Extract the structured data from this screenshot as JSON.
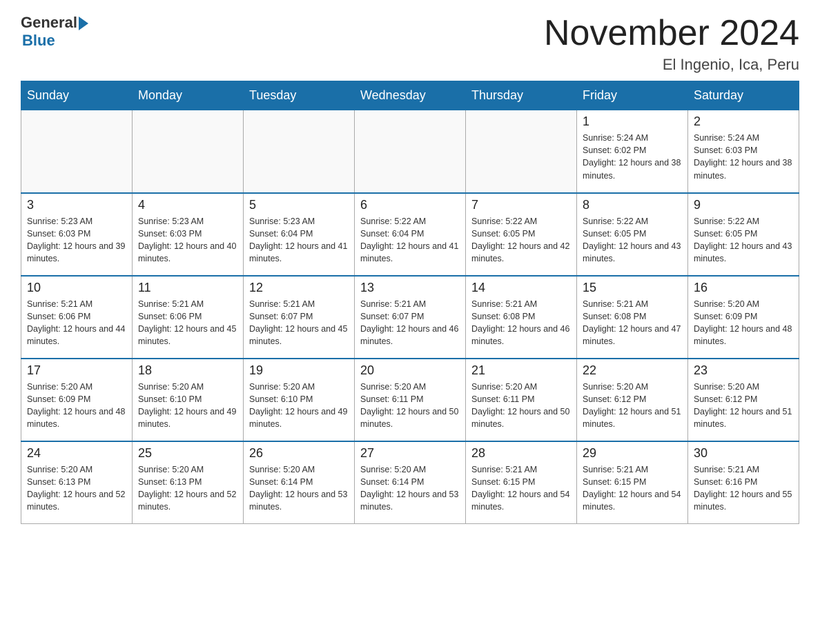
{
  "header": {
    "logo_general": "General",
    "logo_blue": "Blue",
    "month_title": "November 2024",
    "location": "El Ingenio, Ica, Peru"
  },
  "days_of_week": [
    "Sunday",
    "Monday",
    "Tuesday",
    "Wednesday",
    "Thursday",
    "Friday",
    "Saturday"
  ],
  "weeks": [
    [
      {
        "day": "",
        "info": ""
      },
      {
        "day": "",
        "info": ""
      },
      {
        "day": "",
        "info": ""
      },
      {
        "day": "",
        "info": ""
      },
      {
        "day": "",
        "info": ""
      },
      {
        "day": "1",
        "info": "Sunrise: 5:24 AM\nSunset: 6:02 PM\nDaylight: 12 hours and 38 minutes."
      },
      {
        "day": "2",
        "info": "Sunrise: 5:24 AM\nSunset: 6:03 PM\nDaylight: 12 hours and 38 minutes."
      }
    ],
    [
      {
        "day": "3",
        "info": "Sunrise: 5:23 AM\nSunset: 6:03 PM\nDaylight: 12 hours and 39 minutes."
      },
      {
        "day": "4",
        "info": "Sunrise: 5:23 AM\nSunset: 6:03 PM\nDaylight: 12 hours and 40 minutes."
      },
      {
        "day": "5",
        "info": "Sunrise: 5:23 AM\nSunset: 6:04 PM\nDaylight: 12 hours and 41 minutes."
      },
      {
        "day": "6",
        "info": "Sunrise: 5:22 AM\nSunset: 6:04 PM\nDaylight: 12 hours and 41 minutes."
      },
      {
        "day": "7",
        "info": "Sunrise: 5:22 AM\nSunset: 6:05 PM\nDaylight: 12 hours and 42 minutes."
      },
      {
        "day": "8",
        "info": "Sunrise: 5:22 AM\nSunset: 6:05 PM\nDaylight: 12 hours and 43 minutes."
      },
      {
        "day": "9",
        "info": "Sunrise: 5:22 AM\nSunset: 6:05 PM\nDaylight: 12 hours and 43 minutes."
      }
    ],
    [
      {
        "day": "10",
        "info": "Sunrise: 5:21 AM\nSunset: 6:06 PM\nDaylight: 12 hours and 44 minutes."
      },
      {
        "day": "11",
        "info": "Sunrise: 5:21 AM\nSunset: 6:06 PM\nDaylight: 12 hours and 45 minutes."
      },
      {
        "day": "12",
        "info": "Sunrise: 5:21 AM\nSunset: 6:07 PM\nDaylight: 12 hours and 45 minutes."
      },
      {
        "day": "13",
        "info": "Sunrise: 5:21 AM\nSunset: 6:07 PM\nDaylight: 12 hours and 46 minutes."
      },
      {
        "day": "14",
        "info": "Sunrise: 5:21 AM\nSunset: 6:08 PM\nDaylight: 12 hours and 46 minutes."
      },
      {
        "day": "15",
        "info": "Sunrise: 5:21 AM\nSunset: 6:08 PM\nDaylight: 12 hours and 47 minutes."
      },
      {
        "day": "16",
        "info": "Sunrise: 5:20 AM\nSunset: 6:09 PM\nDaylight: 12 hours and 48 minutes."
      }
    ],
    [
      {
        "day": "17",
        "info": "Sunrise: 5:20 AM\nSunset: 6:09 PM\nDaylight: 12 hours and 48 minutes."
      },
      {
        "day": "18",
        "info": "Sunrise: 5:20 AM\nSunset: 6:10 PM\nDaylight: 12 hours and 49 minutes."
      },
      {
        "day": "19",
        "info": "Sunrise: 5:20 AM\nSunset: 6:10 PM\nDaylight: 12 hours and 49 minutes."
      },
      {
        "day": "20",
        "info": "Sunrise: 5:20 AM\nSunset: 6:11 PM\nDaylight: 12 hours and 50 minutes."
      },
      {
        "day": "21",
        "info": "Sunrise: 5:20 AM\nSunset: 6:11 PM\nDaylight: 12 hours and 50 minutes."
      },
      {
        "day": "22",
        "info": "Sunrise: 5:20 AM\nSunset: 6:12 PM\nDaylight: 12 hours and 51 minutes."
      },
      {
        "day": "23",
        "info": "Sunrise: 5:20 AM\nSunset: 6:12 PM\nDaylight: 12 hours and 51 minutes."
      }
    ],
    [
      {
        "day": "24",
        "info": "Sunrise: 5:20 AM\nSunset: 6:13 PM\nDaylight: 12 hours and 52 minutes."
      },
      {
        "day": "25",
        "info": "Sunrise: 5:20 AM\nSunset: 6:13 PM\nDaylight: 12 hours and 52 minutes."
      },
      {
        "day": "26",
        "info": "Sunrise: 5:20 AM\nSunset: 6:14 PM\nDaylight: 12 hours and 53 minutes."
      },
      {
        "day": "27",
        "info": "Sunrise: 5:20 AM\nSunset: 6:14 PM\nDaylight: 12 hours and 53 minutes."
      },
      {
        "day": "28",
        "info": "Sunrise: 5:21 AM\nSunset: 6:15 PM\nDaylight: 12 hours and 54 minutes."
      },
      {
        "day": "29",
        "info": "Sunrise: 5:21 AM\nSunset: 6:15 PM\nDaylight: 12 hours and 54 minutes."
      },
      {
        "day": "30",
        "info": "Sunrise: 5:21 AM\nSunset: 6:16 PM\nDaylight: 12 hours and 55 minutes."
      }
    ]
  ]
}
